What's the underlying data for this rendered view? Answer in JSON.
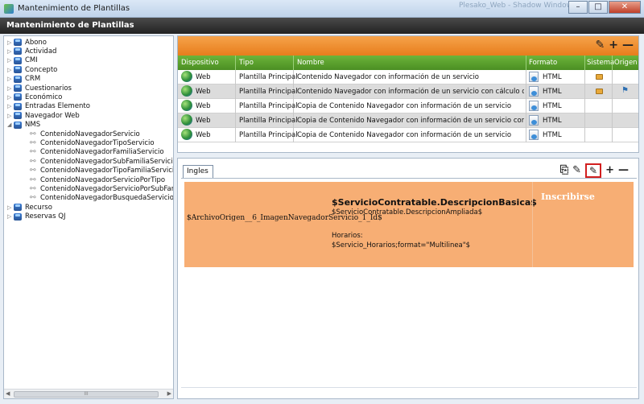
{
  "window": {
    "title": "Mantenimiento de Plantillas",
    "ghost_title": "Plesako_Web - Shadow Window...",
    "buttons": {
      "minimize": "–",
      "maximize": "□",
      "close": "✕"
    }
  },
  "header": {
    "title": "Mantenimiento de Plantillas"
  },
  "tree": {
    "items": [
      {
        "label": "Abono",
        "expander": "▷",
        "kind": "group"
      },
      {
        "label": "Actividad",
        "expander": "▷",
        "kind": "group"
      },
      {
        "label": "CMI",
        "expander": "▷",
        "kind": "group"
      },
      {
        "label": "Concepto",
        "expander": "▷",
        "kind": "group"
      },
      {
        "label": "CRM",
        "expander": "▷",
        "kind": "group"
      },
      {
        "label": "Cuestionarios",
        "expander": "▷",
        "kind": "group"
      },
      {
        "label": "Económico",
        "expander": "▷",
        "kind": "group"
      },
      {
        "label": "Entradas Elemento",
        "expander": "▷",
        "kind": "group"
      },
      {
        "label": "Navegador Web",
        "expander": "▷",
        "kind": "group"
      },
      {
        "label": "NMS",
        "expander": "◢",
        "kind": "group"
      },
      {
        "label": "ContenidoNavegadorServicio",
        "kind": "link"
      },
      {
        "label": "ContenidoNavegadorTipoServicio",
        "kind": "link"
      },
      {
        "label": "ContenidoNavegadorFamiliaServicio",
        "kind": "link"
      },
      {
        "label": "ContenidoNavegadorSubFamiliaServicio",
        "kind": "link"
      },
      {
        "label": "ContenidoNavegadorTipoFamiliaServicio",
        "kind": "link"
      },
      {
        "label": "ContenidoNavegadorServicioPorTipo",
        "kind": "link"
      },
      {
        "label": "ContenidoNavegadorServicioPorSubFamilia",
        "kind": "link"
      },
      {
        "label": "ContenidoNavegadorBusquedaServicio",
        "kind": "link"
      },
      {
        "label": "Recurso",
        "expander": "▷",
        "kind": "group"
      },
      {
        "label": "Reservas QJ",
        "expander": "▷",
        "kind": "group"
      }
    ],
    "scroll_grip": "III"
  },
  "grid": {
    "toolbar": {
      "edit": "✎",
      "add": "+",
      "remove": "—"
    },
    "columns": [
      "Dispositivo",
      "Tipo",
      "Nombre",
      "Formato",
      "Sistema",
      "Origen"
    ],
    "rows": [
      {
        "dispositivo": "Web",
        "tipo": "Plantilla Principal",
        "nombre": "Contenido Navegador con información de un servicio",
        "formato": "HTML",
        "sistema_lock": true,
        "origen_flag": false
      },
      {
        "dispositivo": "Web",
        "tipo": "Plantilla Principal",
        "nombre": "Contenido Navegador con información de un servicio con cálculo de plazas al in",
        "formato": "HTML",
        "sistema_lock": true,
        "origen_flag": true
      },
      {
        "dispositivo": "Web",
        "tipo": "Plantilla Principal",
        "nombre": "Copia de Contenido Navegador con información de un servicio",
        "formato": "HTML",
        "sistema_lock": false,
        "origen_flag": false
      },
      {
        "dispositivo": "Web",
        "tipo": "Plantilla Principal",
        "nombre": "Copia de Contenido Navegador con información de un servicio con cálculo de p",
        "formato": "HTML",
        "sistema_lock": false,
        "origen_flag": false
      },
      {
        "dispositivo": "Web",
        "tipo": "Plantilla Principal",
        "nombre": "Copia de Contenido Navegador con información de un servicio",
        "formato": "HTML",
        "sistema_lock": false,
        "origen_flag": false
      }
    ]
  },
  "editor": {
    "tab": "Ingles",
    "toolbar": {
      "copy": "⎘",
      "edit": "✎",
      "edit_template": "✎",
      "add": "+",
      "remove": "—"
    },
    "template": {
      "image_var": "$ArchivoOrigen__6_ImagenNavegadorServicio_1_Id$",
      "title_var": "$ServicioContratable.DescripcionBasica$",
      "desc_var": "$ServicioContratable.DescripcionAmpliada$",
      "horarios_label": "Horarios:",
      "horarios_var": "$Servicio_Horarios;format=\"Multilinea\"$",
      "button": "Inscribirse"
    }
  },
  "colors": {
    "toolbar_orange": "#e77d1c",
    "header_green": "#4b8e23",
    "template_bg": "#f7ae74",
    "highlight_red": "#d21f1f"
  }
}
